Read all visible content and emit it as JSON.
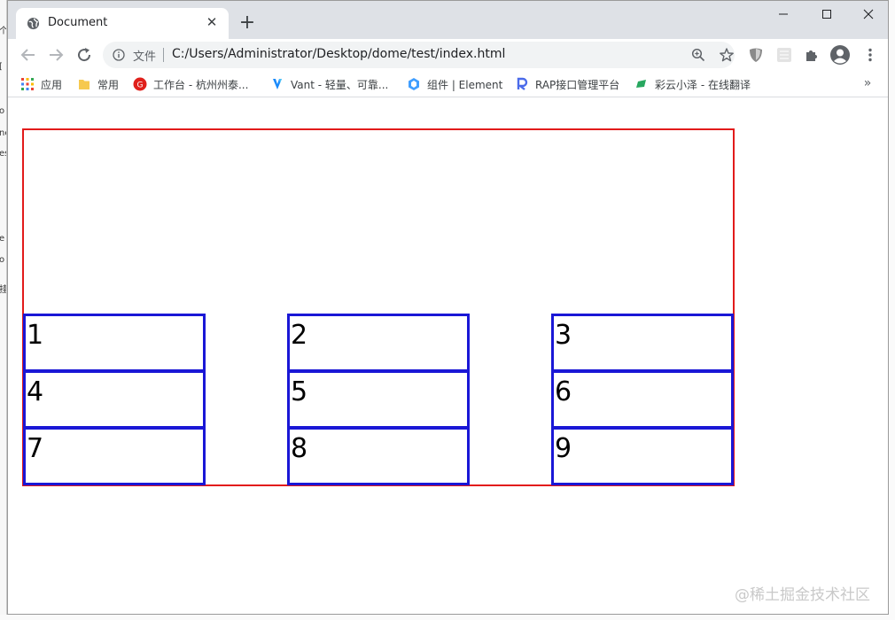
{
  "window": {
    "tab_title": "Document",
    "new_tab_symbol": "+",
    "close_symbol": "✕"
  },
  "toolbar": {
    "scheme_label": "文件",
    "url": "C:/Users/Administrator/Desktop/dome/test/index.html"
  },
  "bookmarks": [
    {
      "label": "应用",
      "icon": "apps-grid-icon"
    },
    {
      "label": "常用",
      "icon": "folder-icon"
    },
    {
      "label": "工作台 - 杭州州泰...",
      "icon": "workbench-icon"
    },
    {
      "label": "Vant - 轻量、可靠...",
      "icon": "vant-icon"
    },
    {
      "label": "组件 | Element",
      "icon": "element-icon"
    },
    {
      "label": "RAP接口管理平台",
      "icon": "rap-icon"
    },
    {
      "label": "彩云小泽 - 在线翻译",
      "icon": "caiyun-icon"
    }
  ],
  "bookmarks_more": "»",
  "page": {
    "items": [
      "1",
      "2",
      "3",
      "4",
      "5",
      "6",
      "7",
      "8",
      "9"
    ],
    "watermark": "@稀土掘金技术社区"
  },
  "colors": {
    "container_border": "#e21b1b",
    "item_border": "#1a17d6",
    "tabstrip": "#dee1e6"
  }
}
